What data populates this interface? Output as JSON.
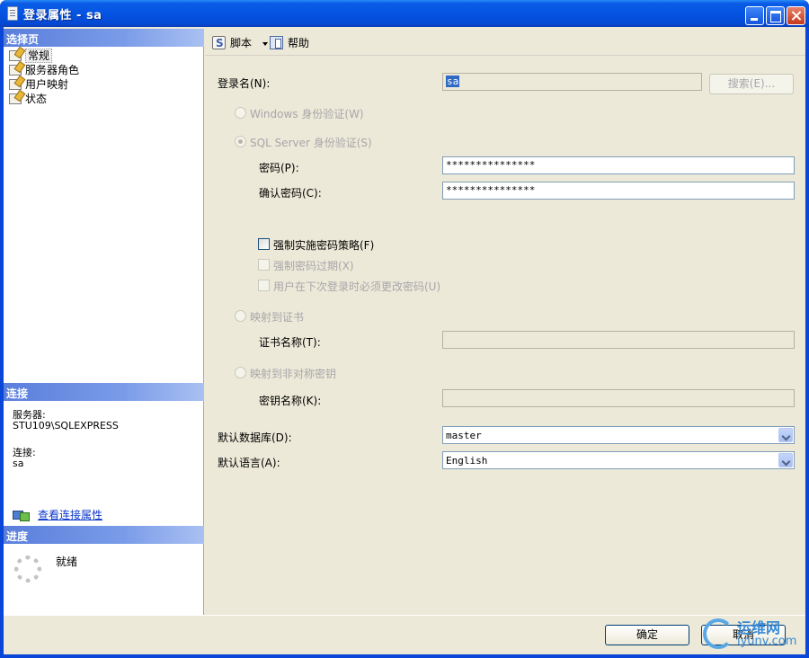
{
  "window": {
    "title": "登录属性 - sa"
  },
  "left": {
    "pages_header": "选择页",
    "pages": [
      {
        "label": "常规"
      },
      {
        "label": "服务器角色"
      },
      {
        "label": "用户映射"
      },
      {
        "label": "状态"
      }
    ],
    "connection_header": "连接",
    "server_label": "服务器:",
    "server_value": "STU109\\SQLEXPRESS",
    "connection_label": "连接:",
    "connection_value": "sa",
    "view_link": "查看连接属性",
    "progress_header": "进度",
    "progress_status": "就绪"
  },
  "toolbar": {
    "script_label": "脚本",
    "help_label": "帮助"
  },
  "form": {
    "login_name_label": "登录名(N):",
    "login_name_value": "sa",
    "search_button": "搜索(E)...",
    "windows_auth": "Windows 身份验证(W)",
    "sql_auth": "SQL Server 身份验证(S)",
    "password_label": "密码(P):",
    "password_value": "***************",
    "confirm_password_label": "确认密码(C):",
    "confirm_password_value": "***************",
    "enforce_policy": "强制实施密码策略(F)",
    "enforce_expiration": "强制密码过期(X)",
    "must_change": "用户在下次登录时必须更改密码(U)",
    "map_certificate": "映射到证书",
    "certificate_name_label": "证书名称(T):",
    "map_asymmetric": "映射到非对称密钥",
    "key_name_label": "密钥名称(K):",
    "default_db_label": "默认数据库(D):",
    "default_db_value": "master",
    "default_lang_label": "默认语言(A):",
    "default_lang_value": "English"
  },
  "buttons": {
    "ok": "确定",
    "cancel": "取消"
  },
  "watermark": {
    "title": "运维网",
    "url": "iyunv.com"
  }
}
